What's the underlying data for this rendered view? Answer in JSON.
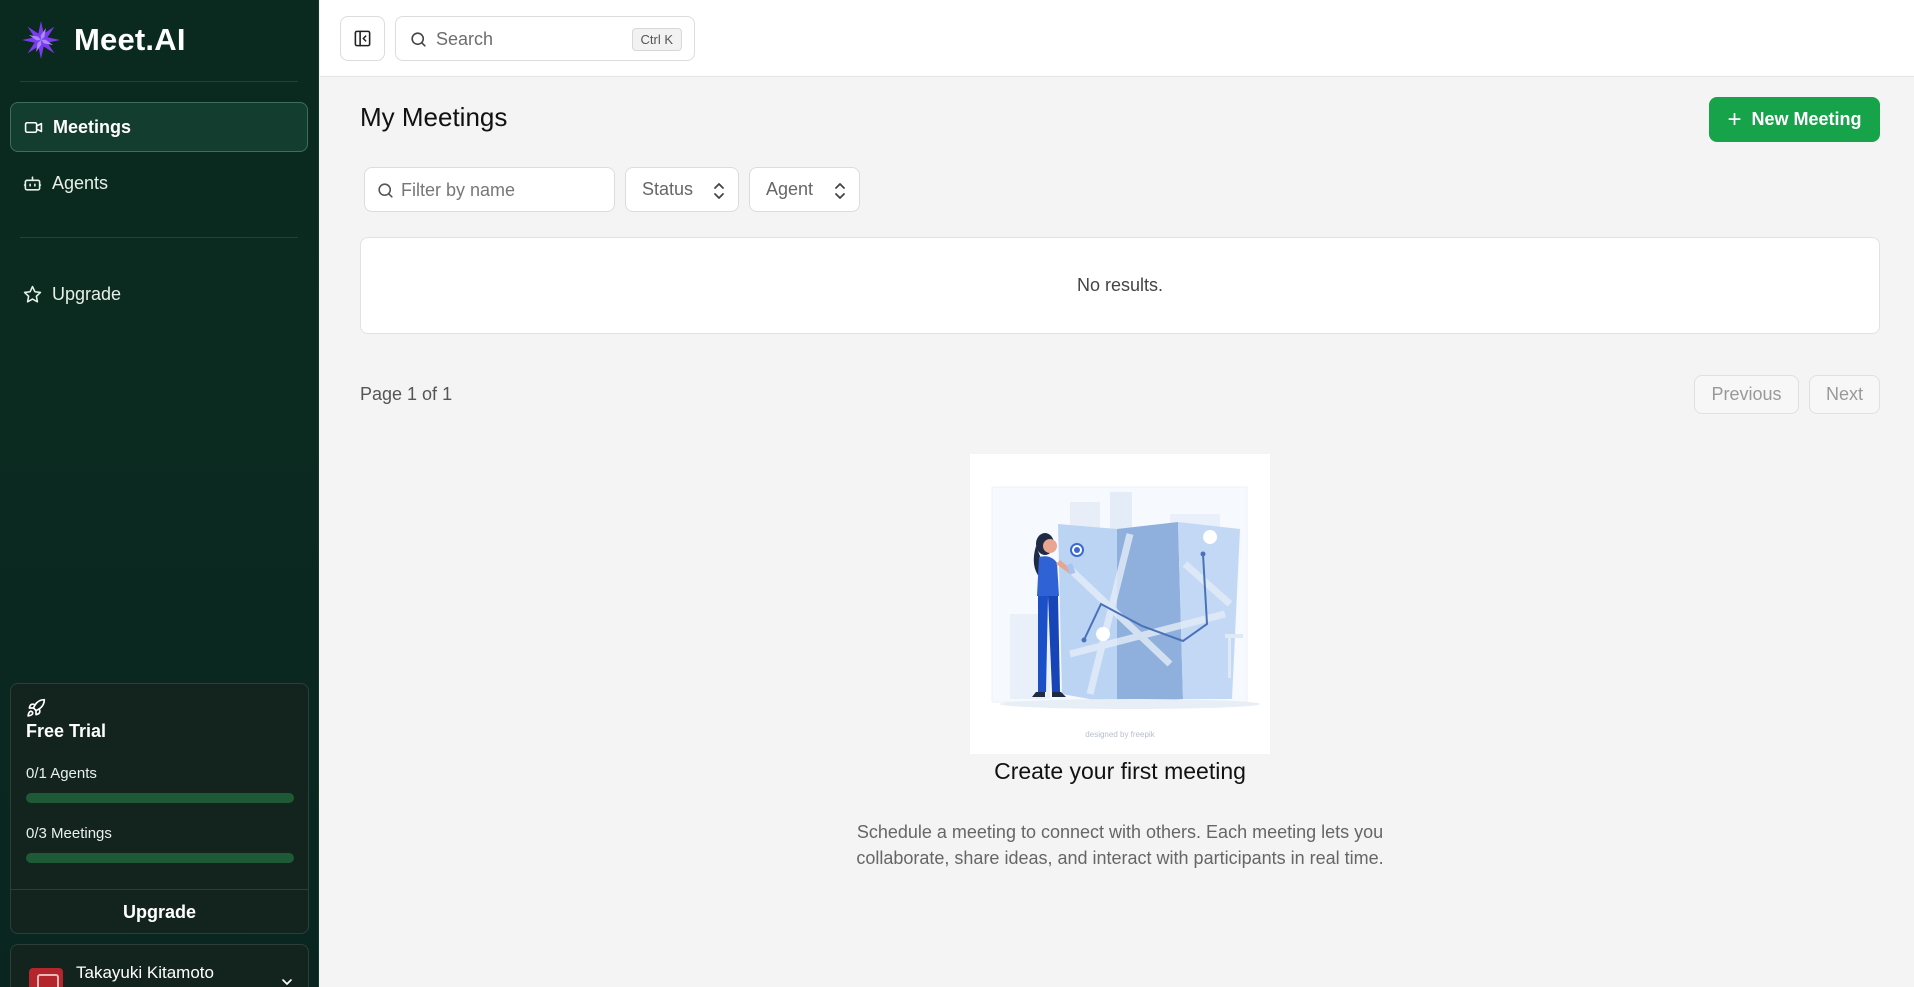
{
  "sidebar": {
    "brand": "Meet.AI",
    "nav": [
      {
        "label": "Meetings",
        "icon": "video-icon",
        "active": true
      },
      {
        "label": "Agents",
        "icon": "bot-icon",
        "active": false
      }
    ],
    "upgrade_label": "Upgrade",
    "trial": {
      "title": "Free Trial",
      "agents_label": "0/1 Agents",
      "agents_progress": 0,
      "meetings_label": "0/3 Meetings",
      "meetings_progress": 0,
      "button": "Upgrade"
    },
    "user": {
      "name": "Takayuki Kitamoto"
    }
  },
  "topbar": {
    "search_placeholder": "Search",
    "shortcut": "Ctrl K"
  },
  "main": {
    "title": "My Meetings",
    "new_button": "New Meeting",
    "filter_placeholder": "Filter by name",
    "status_select": "Status",
    "agent_select": "Agent",
    "results_text": "No results.",
    "page_info": "Page 1 of 1",
    "prev_label": "Previous",
    "next_label": "Next",
    "empty": {
      "title": "Create your first meeting",
      "description": "Schedule a meeting to connect with others. Each meeting lets you collaborate, share ideas, and interact with participants in real time.",
      "credit": "designed by freepik"
    }
  },
  "colors": {
    "sidebar_bg": "#0a2a1f",
    "accent": "#16a34a",
    "logo": "#7c3aed"
  }
}
